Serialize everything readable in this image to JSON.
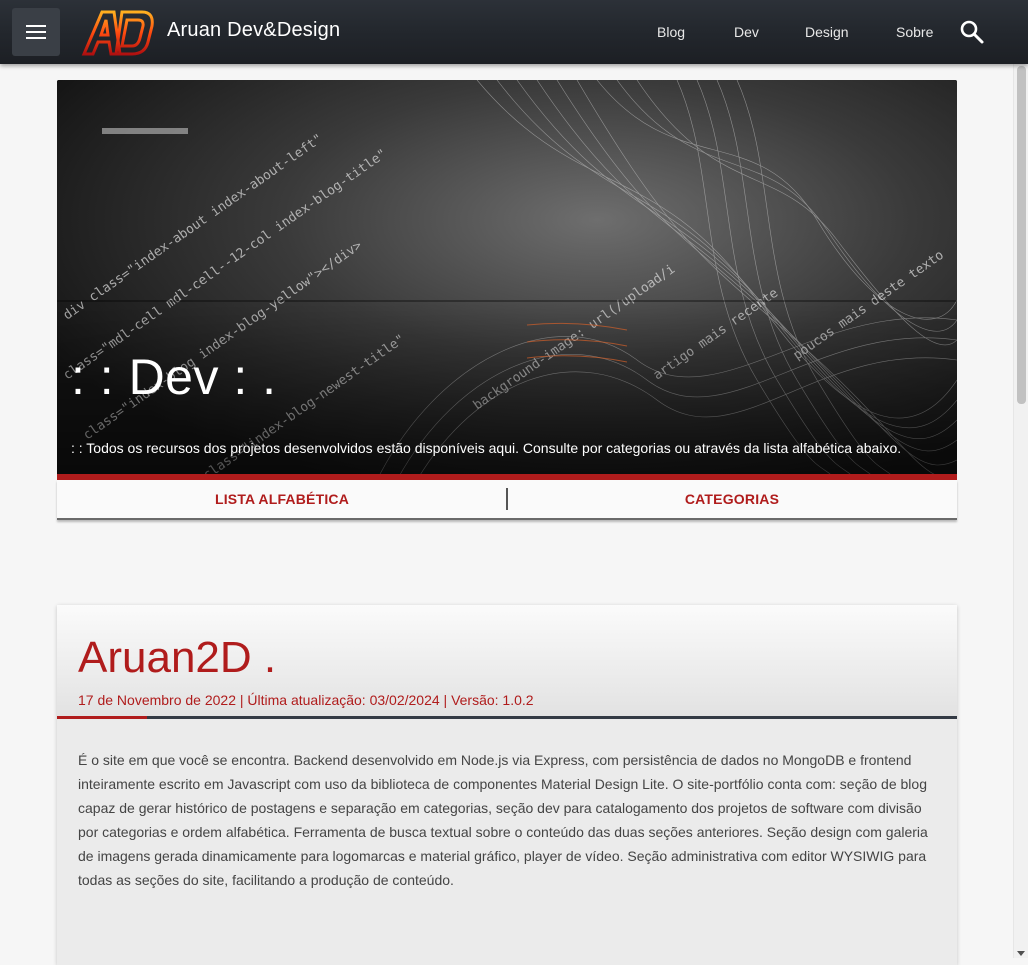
{
  "topbar": {
    "brand": "Aruan Dev&Design",
    "logo_text": "AD",
    "nav": [
      {
        "label": "Blog"
      },
      {
        "label": "Dev"
      },
      {
        "label": "Design"
      },
      {
        "label": "Sobre"
      }
    ],
    "menu_icon": "hamburger-menu-icon",
    "search_icon": "search-icon"
  },
  "hero": {
    "title": ": : Dev : .",
    "description": ": : Todos os recursos dos projetos desenvolvidos estão disponíveis aqui. Consulte por categorias ou através da lista alfabética abaixo."
  },
  "tabs": [
    {
      "label": "LISTA ALFABÉTICA"
    },
    {
      "label": "CATEGORIAS"
    }
  ],
  "article": {
    "title": "Aruan2D .",
    "meta": "17 de Novembro de 2022 | Última atualização: 03/02/2024 | Versão: 1.0.2",
    "body": "É o site em que você se encontra. Backend desenvolvido em Node.js via Express, com persistência de dados no MongoDB e frontend inteiramente escrito em Javascript com uso da biblioteca de componentes Material Design Lite. O site-portfólio conta com: seção de blog capaz de gerar histórico de postagens e separação em categorias, seção dev para catalogamento dos projetos de software com divisão por categorias e ordem alfabética. Ferramenta de busca textual sobre o conteúdo das duas seções anteriores. Seção design com galeria de imagens gerada dinamicamente para logomarcas e material gráfico, player de vídeo. Seção administrativa com editor WYSIWIG para todas as seções do site, facilitando a produção de conteúdo."
  },
  "colors": {
    "accent": "#b01c1c",
    "topbar": "#23272d"
  }
}
